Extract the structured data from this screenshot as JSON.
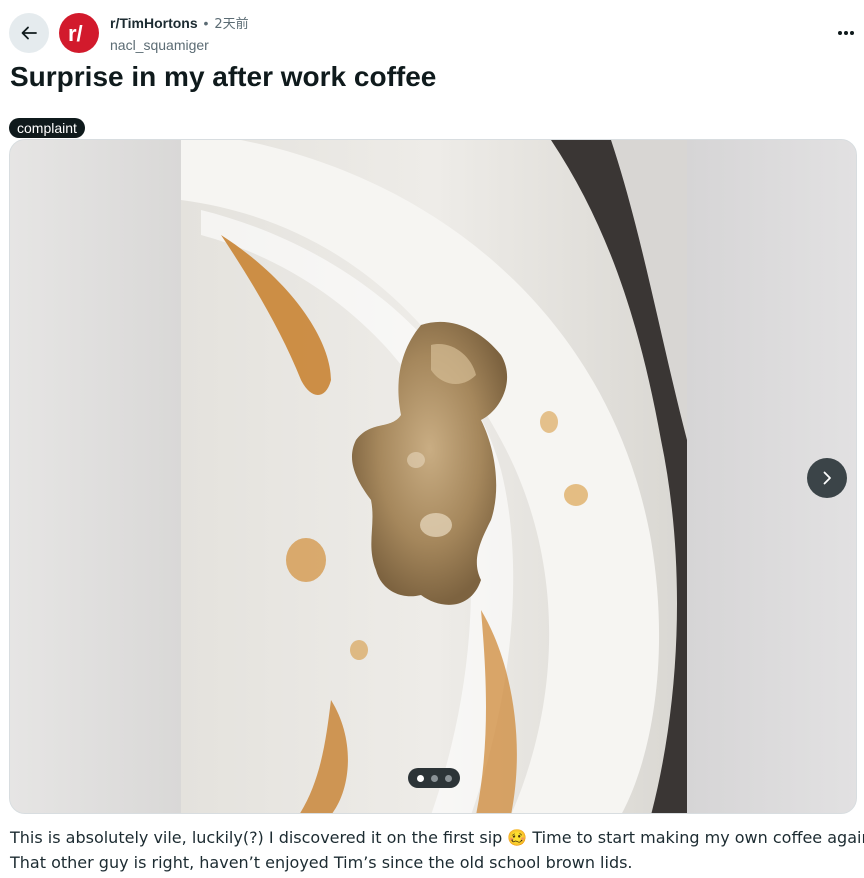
{
  "header": {
    "back_icon": "arrow-left-icon",
    "subreddit_avatar_text": "r/",
    "subreddit": "r/TimHortons",
    "separator": "•",
    "time_ago": "2天前",
    "author": "nacl_squamiger",
    "more_icon": "ellipsis-icon"
  },
  "post": {
    "title": "Surprise in my after work coffee",
    "flair": "complaint",
    "gallery": {
      "next_icon": "chevron-right-icon",
      "image_count": 3,
      "current_index": 1
    },
    "body_lines": [
      "This is absolutely vile, luckily(?) I discovered it on the first sip 🥴  Time to start making my own coffee again.",
      "That other guy is right, haven’t enjoyed Tim’s since the old school brown lids."
    ]
  },
  "colors": {
    "brand": "#d21a2c",
    "flair_bg": "#0f1a1c",
    "button_bg": "#e5ebee"
  }
}
